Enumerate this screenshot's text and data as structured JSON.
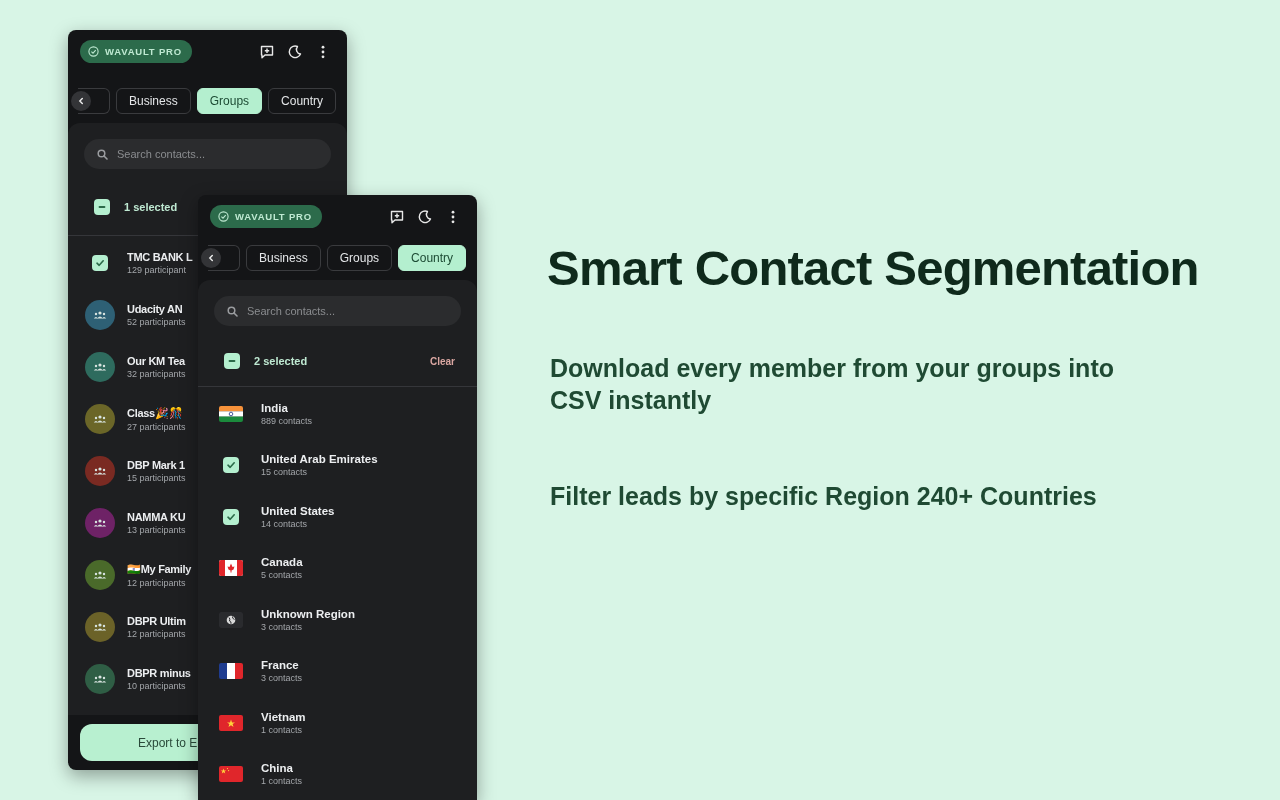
{
  "back_window": {
    "badge": "WAVAULT PRO",
    "tabs": [
      {
        "label": "Business",
        "selected": false
      },
      {
        "label": "Groups",
        "selected": true
      },
      {
        "label": "Country",
        "selected": false
      }
    ],
    "search": {
      "placeholder": "Search contacts..."
    },
    "selection": {
      "indeterminate": true,
      "label": "1 selected"
    },
    "rows": [
      {
        "name": "TMC BANK L",
        "count": "129 participant",
        "checked": true
      },
      {
        "name": "Udacity AN",
        "count": "52 participants",
        "checked": false,
        "kind": "group",
        "color": "#2e6075"
      },
      {
        "name": "Our KM Tea",
        "count": "32 participants",
        "checked": false,
        "kind": "group",
        "color": "#2e6b5e"
      },
      {
        "name": "Class🎉🎊",
        "count": "27 participants",
        "checked": false,
        "kind": "group",
        "color": "#6b6628"
      },
      {
        "name": "DBP Mark 1",
        "count": "15 participants",
        "checked": false,
        "kind": "group",
        "color": "#7a2a22"
      },
      {
        "name": "NAMMA KU",
        "count": "13 participants",
        "checked": false,
        "kind": "group",
        "color": "#6e2266"
      },
      {
        "name": "🇮🇳My Family",
        "count": "12 participants",
        "checked": false,
        "kind": "group",
        "color": "#4a6a2a"
      },
      {
        "name": "DBPR Ultim",
        "count": "12 participants",
        "checked": false,
        "kind": "group",
        "color": "#6b6228"
      },
      {
        "name": "DBPR minus",
        "count": "10 participants",
        "checked": false,
        "kind": "group",
        "color": "#2f5e45"
      }
    ],
    "export_button": "Export to E"
  },
  "front_window": {
    "badge": "WAVAULT PRO",
    "tabs": [
      {
        "label": "Business",
        "selected": false
      },
      {
        "label": "Groups",
        "selected": false
      },
      {
        "label": "Country",
        "selected": true
      }
    ],
    "search": {
      "placeholder": "Search contacts..."
    },
    "selection": {
      "indeterminate": true,
      "label": "2 selected",
      "clear": "Clear"
    },
    "rows": [
      {
        "name": "India",
        "count": "889 contacts",
        "checked": false,
        "kind": "india"
      },
      {
        "name": "United Arab Emirates",
        "count": "15 contacts",
        "checked": true
      },
      {
        "name": "United States",
        "count": "14 contacts",
        "checked": true
      },
      {
        "name": "Canada",
        "count": "5 contacts",
        "checked": false,
        "kind": "canada"
      },
      {
        "name": "Unknown Region",
        "count": "3 contacts",
        "checked": false,
        "kind": "globe"
      },
      {
        "name": "France",
        "count": "3 contacts",
        "checked": false,
        "kind": "france"
      },
      {
        "name": "Vietnam",
        "count": "1 contacts",
        "checked": false,
        "kind": "vietnam"
      },
      {
        "name": "China",
        "count": "1 contacts",
        "checked": false,
        "kind": "china"
      }
    ]
  },
  "headline": "Smart Contact Segmentation",
  "features": [
    "Download every member from your groups into CSV instantly",
    "Filter leads by specific Region 240+ Countries"
  ]
}
